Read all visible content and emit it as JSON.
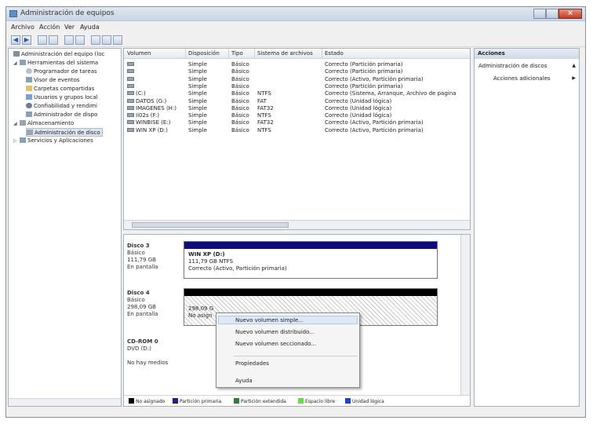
{
  "window": {
    "title": "Administración de equipos"
  },
  "menu": [
    "Archivo",
    "Acción",
    "Ver",
    "Ayuda"
  ],
  "tree": [
    "Administración del equipo (loc",
    "Herramientas del sistema",
    "Programador de tareas",
    "Visor de eventos",
    "Carpetas compartidas",
    "Usuarios y grupos local",
    "Confiabilidad y rendimi",
    "Administrador de dispo",
    "Almacenamiento",
    "Administración de disco",
    "Servicios y Aplicaciones"
  ],
  "volumes": {
    "headers": [
      "Volumen",
      "Disposición",
      "Tipo",
      "Sistema de archivos",
      "Estado"
    ],
    "rows": [
      [
        "",
        "Simple",
        "Básico",
        "",
        "Correcto (Partición primaria)"
      ],
      [
        "",
        "Simple",
        "Básico",
        "",
        "Correcto (Partición primaria)"
      ],
      [
        "",
        "Simple",
        "Básico",
        "",
        "Correcto (Activo, Partición primaria)"
      ],
      [
        "",
        "Simple",
        "Básico",
        "",
        "Correcto (Partición primaria)"
      ],
      [
        "(C:)",
        "Simple",
        "Básico",
        "NTFS",
        "Correcto (Sistema, Arranque, Archivo de pagina"
      ],
      [
        "DATOS (G:)",
        "Simple",
        "Básico",
        "FAT",
        "Correcto (Unidad lógica)"
      ],
      [
        "IMAGENES (H:)",
        "Simple",
        "Básico",
        "FAT32",
        "Correcto (Unidad lógica)"
      ],
      [
        "Ii02s (F:)",
        "Simple",
        "Básico",
        "NTFS",
        "Correcto (Unidad lógica)"
      ],
      [
        "WINBISE (E:)",
        "Simple",
        "Básico",
        "FAT32",
        "Correcto (Activo, Partición primaria)"
      ],
      [
        "WIN XP (D:)",
        "Simple",
        "Básico",
        "NTFS",
        "Correcto (Activo, Partición primaria)"
      ]
    ]
  },
  "disks": {
    "disk3": {
      "name": "Disco 3",
      "type": "Básico",
      "size": "111,79 GB",
      "state": "En pantalla",
      "part_name": "WIN XP (D:)",
      "part_size": "111,79 GB NTFS",
      "part_state": "Correcto (Activo, Partición primaria)"
    },
    "disk4": {
      "name": "Disco 4",
      "type": "Básico",
      "size": "298,09 GB",
      "state": "En pantalla",
      "part_size": "298,09 G",
      "part_state": "No asign"
    },
    "cdrom": {
      "name": "CD-ROM 0",
      "type": "DVD (D:)",
      "state": "No hay medios"
    }
  },
  "legend": [
    {
      "label": "No asignado",
      "color": "#000000"
    },
    {
      "label": "Partición primaria",
      "color": "#1a237e"
    },
    {
      "label": "Partición extendida",
      "color": "#2e7d32"
    },
    {
      "label": "Espacio libre",
      "color": "#66dd44"
    },
    {
      "label": "Unidad lógica",
      "color": "#2244cc"
    }
  ],
  "actions": {
    "title": "Acciones",
    "items": [
      "Administración de discos",
      "Acciones adicionales"
    ]
  },
  "context_menu": [
    "Nuevo volumen simple...",
    "Nuevo volumen distribuido...",
    "Nuevo volumen seccionado...",
    "Propiedades",
    "Ayuda"
  ],
  "colors": {
    "primary_partition_bar": "#0c0c7a",
    "unallocated_bar": "#000000"
  }
}
